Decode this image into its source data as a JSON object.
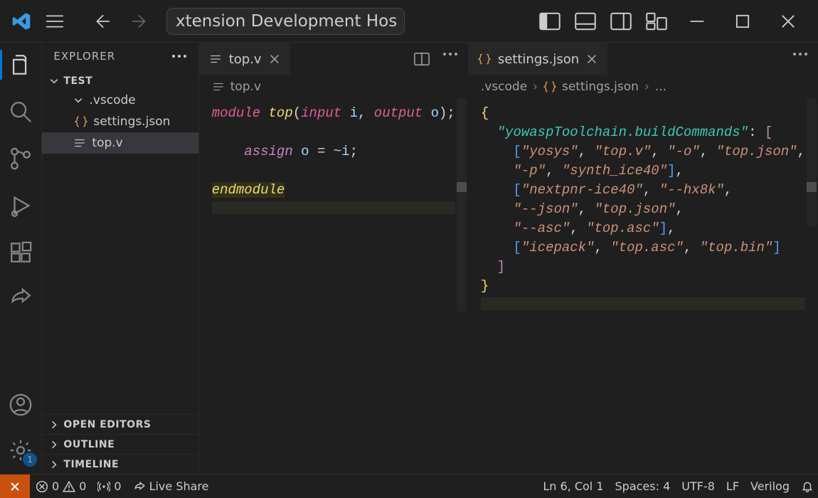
{
  "title": "[Extension Development Host] — top.v — test",
  "titleVisible": "xtension Development Hos",
  "explorer": {
    "title": "EXPLORER",
    "root": "TEST",
    "folders": [
      {
        "name": ".vscode",
        "children": [
          {
            "name": "settings.json",
            "icon": "braces",
            "selected": false
          }
        ]
      }
    ],
    "rootFiles": [
      {
        "name": "top.v",
        "icon": "lines",
        "selected": true
      }
    ],
    "collapsed": [
      "OPEN EDITORS",
      "OUTLINE",
      "TIMELINE"
    ]
  },
  "editorLeft": {
    "tabLabel": "top.v",
    "breadcrumb": [
      "top.v"
    ],
    "code": {
      "l1_kw1": "module",
      "l1_func": "top",
      "l1_open": "(",
      "l1_kw2": "input",
      "l1_id1": "i",
      "l1_comma": ",",
      "l1_kw3": "output",
      "l1_id2": "o",
      "l1_close": ");",
      "l3_kw": "assign",
      "l3_lhs": "o",
      "l3_eq": "=",
      "l3_tilde": "~",
      "l3_rhs": "i",
      "l3_semi": ";",
      "l5_kw": "endmodule"
    }
  },
  "editorRight": {
    "tabLabel": "settings.json",
    "breadcrumb": [
      ".vscode",
      "settings.json",
      "..."
    ],
    "jsonKey": "\"yowaspToolchain.buildCommands\"",
    "buildCommands": [
      [
        "\"yosys\"",
        "\"top.v\"",
        "\"-o\"",
        "\"top.json\"",
        "\"-p\"",
        "\"synth_ice40\""
      ],
      [
        "\"nextpnr-ice40\"",
        "\"--hx8k\"",
        "\"--json\"",
        "\"top.json\"",
        "\"--asc\"",
        "\"top.asc\""
      ],
      [
        "\"icepack\"",
        "\"top.asc\"",
        "\"top.bin\""
      ]
    ]
  },
  "status": {
    "errors": "0",
    "warnings": "0",
    "ports": "0",
    "liveShare": "Live Share",
    "lineCol": "Ln 6, Col 1",
    "spaces": "Spaces: 4",
    "encoding": "UTF-8",
    "eol": "LF",
    "language": "Verilog"
  },
  "activityBadge": "1"
}
